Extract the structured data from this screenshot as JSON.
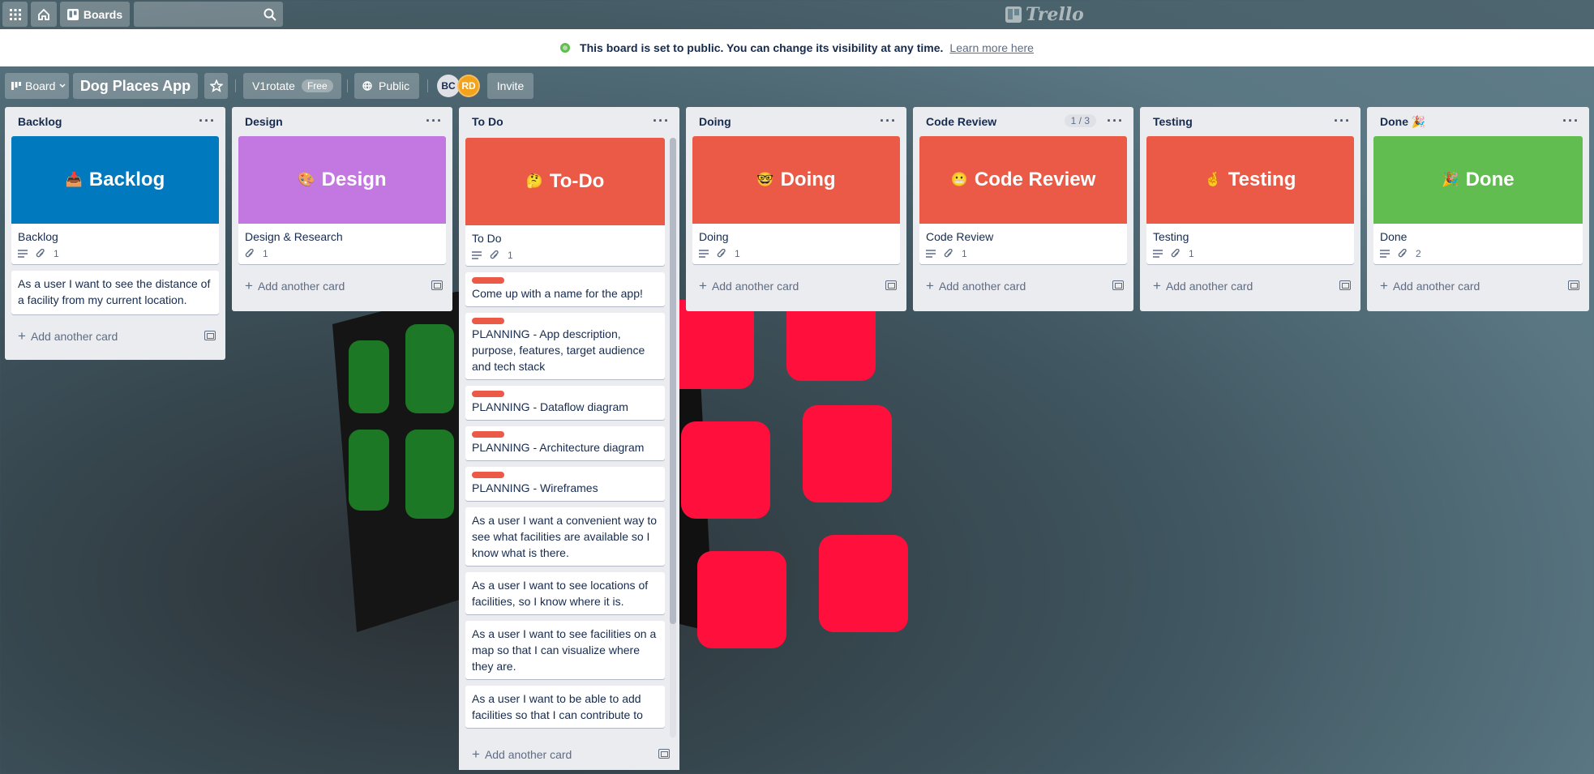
{
  "topbar": {
    "boards_label": "Boards",
    "search_value": "",
    "logo_text": "Trello"
  },
  "banner": {
    "message": "This board is set to public. You can change its visibility at any time.",
    "link": "Learn more here"
  },
  "board_header": {
    "view_label": "Board",
    "title": "Dog Places App",
    "team_name": "V1rotate",
    "team_badge": "Free",
    "visibility": "Public",
    "members": [
      "BC",
      "RD"
    ],
    "invite_label": "Invite"
  },
  "lists": [
    {
      "title": "Backlog",
      "cover_card": {
        "emoji": "📥",
        "cover_text": "Backlog",
        "cover_color": "#0079bf",
        "title": "Backlog",
        "attachments": "1",
        "has_description": true
      },
      "cards": [
        {
          "title": "As a user I want to see the distance of a facility from my current location."
        }
      ],
      "add_label": "Add another card"
    },
    {
      "title": "Design",
      "cover_card": {
        "emoji": "🎨",
        "cover_text": "Design",
        "cover_color": "#c377e0",
        "title": "Design & Research",
        "attachments": "1",
        "has_description": false
      },
      "cards": [],
      "add_label": "Add another card"
    },
    {
      "title": "To Do",
      "cover_card": {
        "emoji": "🤔",
        "cover_text": "To-Do",
        "cover_color": "#eb5a46",
        "title": "To Do",
        "attachments": "1",
        "has_description": true
      },
      "cards": [
        {
          "title": "Come up with a name for the app!",
          "labeled": true
        },
        {
          "title": "PLANNING - App description, purpose, features, target audience and tech stack",
          "labeled": true
        },
        {
          "title": "PLANNING - Dataflow diagram",
          "labeled": true
        },
        {
          "title": "PLANNING - Architecture diagram",
          "labeled": true
        },
        {
          "title": "PLANNING - Wireframes",
          "labeled": true
        },
        {
          "title": "As a user I want a convenient way to see what facilities are available so I know what is there.",
          "labeled": false
        },
        {
          "title": "As a user I want to see locations of facilities, so I know where it is.",
          "labeled": false
        },
        {
          "title": "As a user I want to see facilities on a map so that I can visualize where they are.",
          "labeled": false
        },
        {
          "title": "As a user I want to be able to add facilities so that I can contribute to",
          "labeled": false
        }
      ],
      "add_label": "Add another card"
    },
    {
      "title": "Doing",
      "cover_card": {
        "emoji": "🤓",
        "cover_text": "Doing",
        "cover_color": "#eb5a46",
        "title": "Doing",
        "attachments": "1",
        "has_description": true
      },
      "cards": [],
      "add_label": "Add another card"
    },
    {
      "title": "Code Review",
      "limit": "1 / 3",
      "cover_card": {
        "emoji": "😬",
        "cover_text": "Code Review",
        "cover_color": "#eb5a46",
        "title": "Code Review",
        "attachments": "1",
        "has_description": true
      },
      "cards": [],
      "add_label": "Add another card"
    },
    {
      "title": "Testing",
      "cover_card": {
        "emoji": "🤞",
        "cover_text": "Testing",
        "cover_color": "#eb5a46",
        "title": "Testing",
        "attachments": "1",
        "has_description": true
      },
      "cards": [],
      "add_label": "Add another card"
    },
    {
      "title": "Done 🎉",
      "cover_card": {
        "emoji": "🎉",
        "cover_text": "Done",
        "cover_color": "#61bd4f",
        "title": "Done",
        "attachments": "2",
        "has_description": true
      },
      "cards": [],
      "add_label": "Add another card"
    }
  ],
  "colors": {
    "label_red": "#eb5a46",
    "list_bg": "#ebecf0",
    "accent_blue": "#0079bf"
  }
}
